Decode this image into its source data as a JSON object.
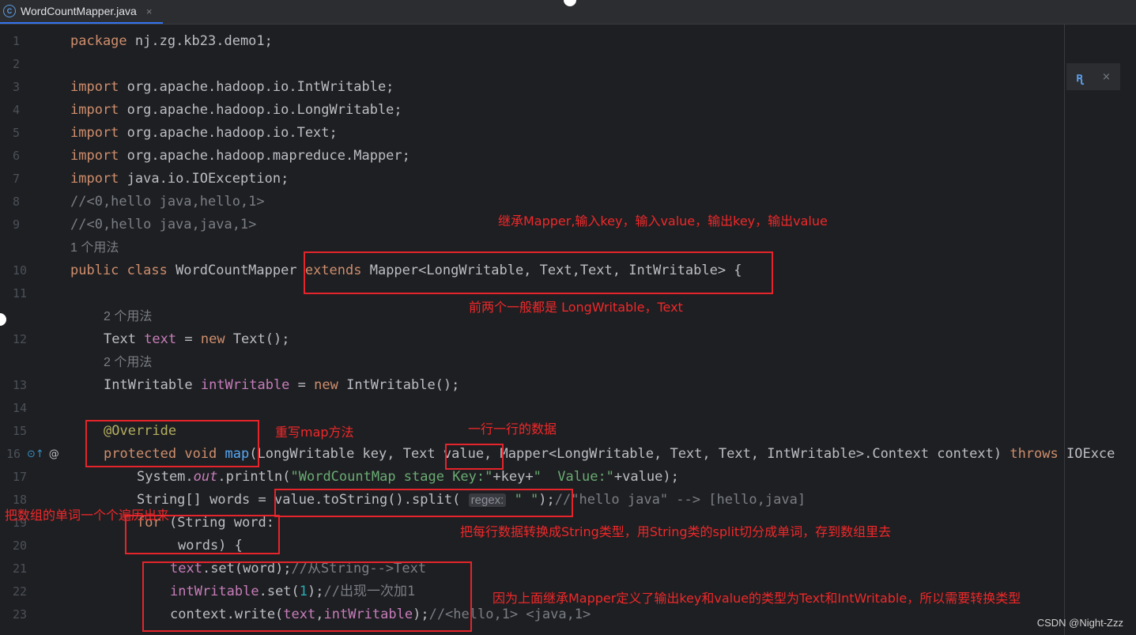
{
  "tab": {
    "icon": "class-icon",
    "title": "WordCountMapper.java",
    "close": "×"
  },
  "lines": {
    "n1": "1",
    "n2": "2",
    "n3": "3",
    "n4": "4",
    "n5": "5",
    "n6": "6",
    "n7": "7",
    "n8": "8",
    "n9": "9",
    "n10": "10",
    "n11": "11",
    "n12": "12",
    "n13": "13",
    "n14": "14",
    "n15": "15",
    "n16": "16",
    "n17": "17",
    "n18": "18",
    "n19": "19",
    "n20": "20",
    "n21": "21",
    "n22": "22",
    "n23": "23"
  },
  "code": {
    "l1_kw": "package",
    "l1_rest": " nj.zg.kb23.demo1;",
    "imp": "import",
    "l3_rest": " org.apache.hadoop.io.IntWritable;",
    "l4_rest": " org.apache.hadoop.io.LongWritable;",
    "l5_rest": " org.apache.hadoop.io.Text;",
    "l6_rest": " org.apache.hadoop.mapreduce.Mapper;",
    "l7_rest": " java.io.IOException;",
    "l8": "//<0,hello java,hello,1>",
    "l9": "//<0,hello java,java,1>",
    "usage1": "1 个用法",
    "l10_kw": "public class",
    "l10_name": " WordCountMapper ",
    "l10_ext": "extends",
    "l10_rest": " Mapper<LongWritable, Text,Text, IntWritable> {",
    "usage2": "2 个用法",
    "l12_type": "Text ",
    "l12_field": "text",
    "l12_eq": " = ",
    "l12_new": "new",
    "l12_rest": " Text();",
    "usage3": "2 个用法",
    "l13_type": "IntWritable ",
    "l13_field": "intWritable",
    "l13_eq": " = ",
    "l13_new": "new",
    "l13_rest": " IntWritable();",
    "l15": "@Override",
    "l16_kw": "protected void",
    "l16_fn": " map",
    "l16_rest": "(LongWritable key, Text value, Mapper<LongWritable, Text, Text, IntWritable>.Context context) ",
    "l16_throws": "throws",
    "l16_exc": " IOExce",
    "l17_a": "System.",
    "l17_out": "out",
    "l17_b": ".println(",
    "l17_s1": "\"WordCountMap stage Key:\"",
    "l17_c": "+key+",
    "l17_s2": "\"  Value:\"",
    "l17_d": "+value);",
    "l18_a": "String[] words = value.toString().split( ",
    "l18_hint": "regex:",
    "l18_s": " \" \"",
    "l18_b": ");",
    "l18_cm": "//\"hello java\" --> [hello,java]",
    "l19_kw": "for",
    "l19_rest": " (String word:",
    "l20": "words) {",
    "l21_f": "text",
    "l21_a": ".set(word);",
    "l21_cm": "//从String-->Text",
    "l22_f": "intWritable",
    "l22_a": ".set(",
    "l22_n": "1",
    "l22_b": ");",
    "l22_cm": "//出现一次加1",
    "l23_a": "context.write(",
    "l23_f1": "text",
    "l23_b": ",",
    "l23_f2": "intWritable",
    "l23_c": ");",
    "l23_cm": "//<hello,1> <java,1>"
  },
  "gutter": {
    "override_icon": "override-icon",
    "override_glyph": "⊙↑",
    "annot_icon": "at-icon",
    "annot_glyph": "@"
  },
  "reader_mode": {
    "icon": "reader-mode-icon",
    "glyph": "ꭆ",
    "close": "×"
  },
  "annotations": {
    "a1": "继承Mapper,输入key，输入value，输出key，输出value",
    "a2": "前两个一般都是 LongWritable，Text",
    "a3": "重写map方法",
    "a4": "一行一行的数据",
    "a5": "把数组的单词一个个遍历出来",
    "a6": "把每行数据转换成String类型，用String类的split切分成单词，存到数组里去",
    "a7": "因为上面继承Mapper定义了输出key和value的类型为Text和IntWritable，所以需要转换类型"
  },
  "watermark": "CSDN @Night-Zzz"
}
